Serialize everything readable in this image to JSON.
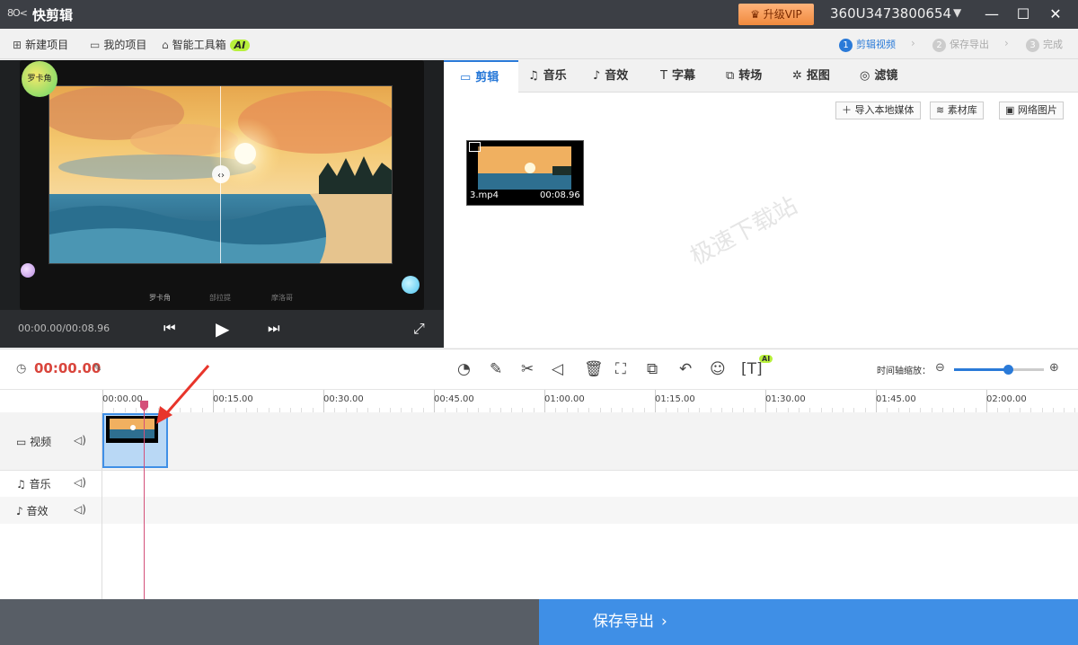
{
  "app": {
    "logo": "8O<",
    "name": "快剪辑",
    "vip_label": "升级VIP",
    "user": "360U3473800654"
  },
  "toolbar": {
    "new_project": "新建项目",
    "my_projects": "我的项目",
    "smart_tools": "智能工具箱",
    "ai": "AI"
  },
  "steps": [
    {
      "num": "1",
      "label": "剪辑视频"
    },
    {
      "num": "2",
      "label": "保存导出"
    },
    {
      "num": "3",
      "label": "完成"
    }
  ],
  "preview": {
    "badge": "罗卡角",
    "subtitles": [
      "罗卡角",
      "部拉提",
      "摩洛哥"
    ],
    "time": "00:00.00/00:08.96"
  },
  "tabs": [
    "剪辑",
    "音乐",
    "音效",
    "字幕",
    "转场",
    "抠图",
    "滤镜"
  ],
  "media": {
    "import_local": "导入本地媒体",
    "library": "素材库",
    "web_images": "网络图片",
    "clip_name": "3.mp4",
    "clip_duration": "00:08.96",
    "watermark": "极速下载站"
  },
  "timeline": {
    "current_time": "00:00.00",
    "zoom_label": "时间轴缩放：",
    "zoom_level": 0.6,
    "ticks": [
      "00:00.00",
      "00:15.00",
      "00:30.00",
      "00:45.00",
      "01:00.00",
      "01:15.00",
      "01:30.00",
      "01:45.00",
      "02:00.00"
    ],
    "tracks": {
      "video": "视频",
      "music": "音乐",
      "effects": "音效"
    }
  },
  "export": {
    "label": "保存导出"
  },
  "colors": {
    "accent": "#2a7ad8",
    "time_red": "#d9453c",
    "export_blue": "#3f8fe6"
  }
}
